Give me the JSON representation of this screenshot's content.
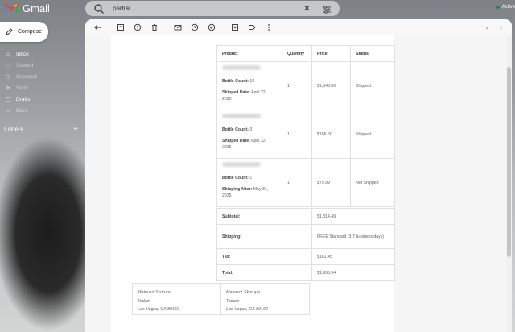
{
  "app": {
    "name": "Gmail"
  },
  "search": {
    "query": "partial"
  },
  "status": {
    "label": "Active"
  },
  "sidebar": {
    "compose_label": "Compose",
    "items": [
      {
        "label": "Inbox",
        "icon": "inbox-icon",
        "count": ""
      },
      {
        "label": "Starred",
        "icon": "star-icon",
        "count": ""
      },
      {
        "label": "Snoozed",
        "icon": "clock-icon",
        "count": ""
      },
      {
        "label": "Sent",
        "icon": "send-icon",
        "count": ""
      },
      {
        "label": "Drafts",
        "icon": "draft-icon",
        "count": ""
      },
      {
        "label": "More",
        "icon": "chevron-down-icon",
        "count": ""
      }
    ],
    "labels_heading": "Labels"
  },
  "order": {
    "headers": {
      "product": "Product",
      "quantity": "Quantity",
      "price": "Price",
      "status": "Status"
    },
    "rows": [
      {
        "field1_label": "Bottle Count:",
        "field1_value": "12",
        "field2_label": "Shipped Date:",
        "field2_value": "April 22, 2025",
        "quantity": "1",
        "price": "$1,548.00",
        "status": "Shipped"
      },
      {
        "field1_label": "Bottle Count:",
        "field1_value": "3",
        "field2_label": "Shipped Date:",
        "field2_value": "April 22, 2025",
        "quantity": "1",
        "price": "$186.50",
        "status": "Shipped"
      },
      {
        "field1_label": "Bottle Count:",
        "field1_value": "1",
        "field2_label": "Shipping After:",
        "field2_value": "May 31, 2025",
        "quantity": "1",
        "price": "$79.99",
        "status": "Not Shipped"
      }
    ],
    "totals": [
      {
        "label": "Subtotal:",
        "value": "$1,814.49"
      },
      {
        "label": "Shipping:",
        "value": "FREE Standard (3-7 business days)"
      },
      {
        "label": "Tax:",
        "value": "$181.45"
      },
      {
        "label": "Total:",
        "value": "$1,995.94"
      }
    ]
  },
  "addresses": [
    {
      "name": "Mateusz Skorupa",
      "company": "Tadam",
      "city": "Las Vegas, CA 89169"
    },
    {
      "name": "Mateusz Skorupa",
      "company": "Tadam",
      "city": "Las Vegas, CA 89169"
    }
  ]
}
